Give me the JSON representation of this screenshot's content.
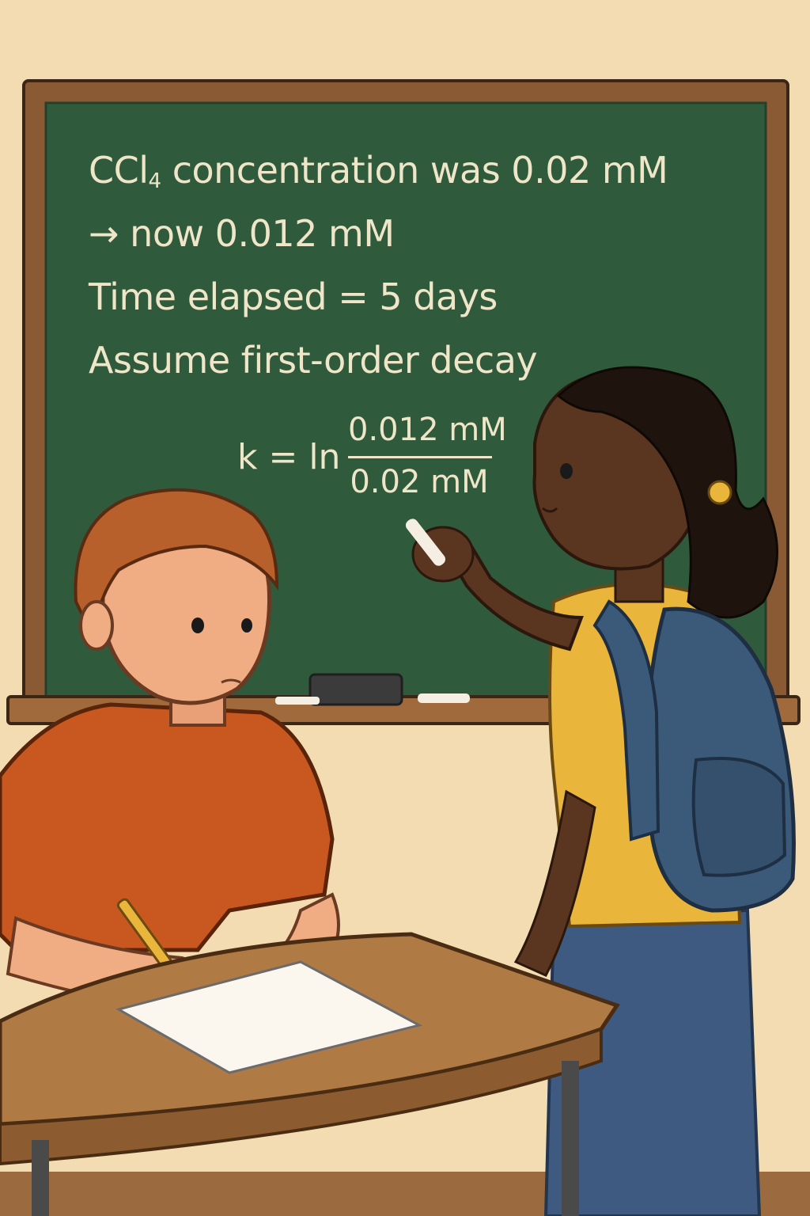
{
  "board": {
    "line1_prefix": "CCl",
    "line1_sub": "4",
    "line1_rest": " concentration  was 0.02 mM",
    "line2": "→  now 0.012 mM",
    "line3": "Time elapsed = 5 days",
    "line4": "Assume first-order decay",
    "formula": {
      "lhs": "k = ln",
      "numerator": "0.012 mM",
      "denominator": "0.02 mM"
    }
  },
  "colors": {
    "wall": "#f3dcb1",
    "chalkboard": "#2f5a3b",
    "board_frame": "#8a5a34",
    "chalk": "#efe6c9",
    "boy_shirt": "#c8581f",
    "girl_shirt": "#e9b53a",
    "backpack": "#3b5a7a",
    "jeans": "#3e5a80",
    "desk": "#b07a45"
  }
}
